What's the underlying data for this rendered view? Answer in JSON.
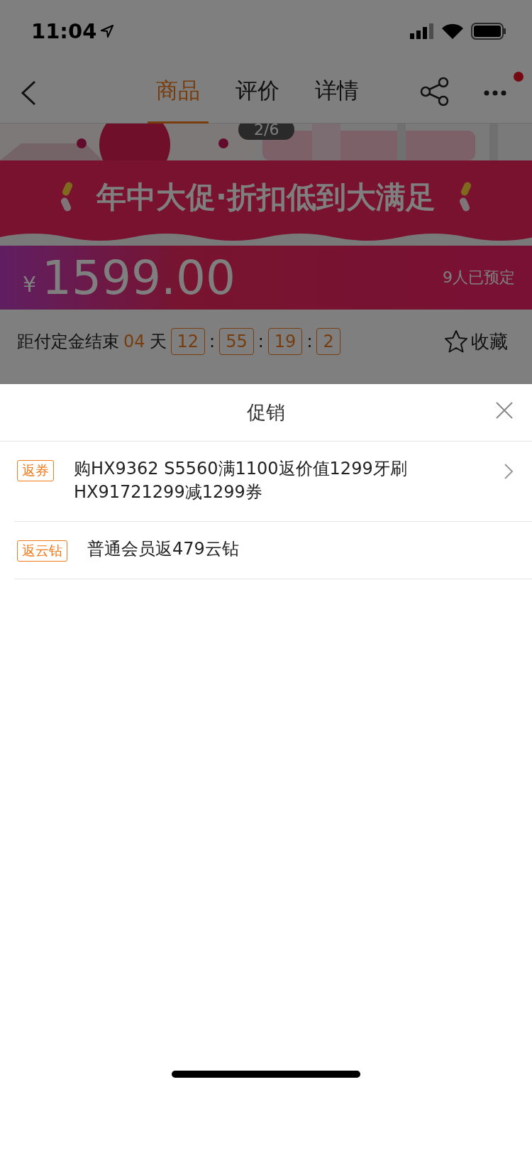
{
  "status_bar": {
    "time": "11:04"
  },
  "nav": {
    "tabs": [
      {
        "label": "商品",
        "selected": true
      },
      {
        "label": "评价",
        "selected": false
      },
      {
        "label": "详情",
        "selected": false
      }
    ],
    "more_badge": true
  },
  "gallery": {
    "counter": "2/6"
  },
  "banner": {
    "title": "年中大促·折扣低到大满足"
  },
  "price": {
    "currency": "¥",
    "amount": "1599.00",
    "reservations": "9人已预定"
  },
  "countdown": {
    "label": "距付定金结束",
    "days": "04",
    "days_unit": "天",
    "units": [
      "12",
      "55",
      "19",
      "2"
    ],
    "separator": ":",
    "favorite": "收藏"
  },
  "sheet": {
    "title": "促销",
    "items": [
      {
        "tag": "返券",
        "text": "购HX9362 S5560满1100返价值1299牙刷HX91721299减1299券",
        "has_arrow": true
      },
      {
        "tag": "返云钻",
        "text": "普通会员返479云钻",
        "has_arrow": false
      }
    ]
  }
}
